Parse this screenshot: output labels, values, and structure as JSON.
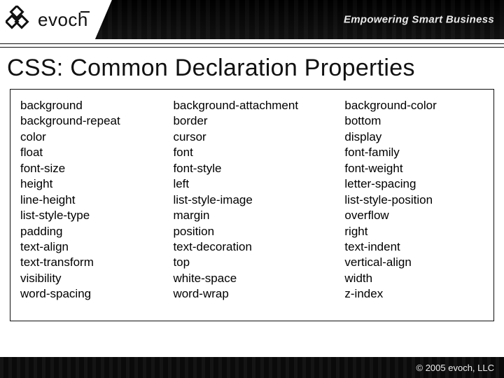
{
  "brand": {
    "name": "evoch",
    "tagline": "Empowering Smart Business"
  },
  "title": "CSS: Common Declaration Properties",
  "columns": [
    [
      "background",
      "background-repeat",
      "color",
      "float",
      "font-size",
      "height",
      "line-height",
      "list-style-type",
      "padding",
      "text-align",
      "text-transform",
      "visibility",
      "word-spacing"
    ],
    [
      "background-attachment",
      "border",
      "cursor",
      "font",
      "font-style",
      "left",
      "list-style-image",
      "margin",
      "position",
      "text-decoration",
      "top",
      "white-space",
      "word-wrap"
    ],
    [
      "background-color",
      "bottom",
      "display",
      "font-family",
      "font-weight",
      "letter-spacing",
      "list-style-position",
      "overflow",
      "right",
      "text-indent",
      "vertical-align",
      "width",
      "z-index"
    ]
  ],
  "footer": {
    "copyright": "© 2005  evoch, LLC"
  }
}
